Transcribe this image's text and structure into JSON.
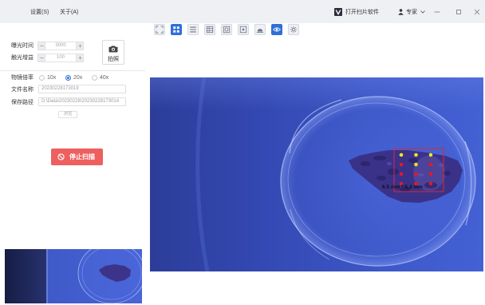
{
  "window": {
    "menu": [
      {
        "label": "设置(S)"
      },
      {
        "label": "关于(A)"
      }
    ],
    "open_scanner_label": "打开扫片软件",
    "user_name": "专家"
  },
  "toolbar": {
    "icons": [
      {
        "icon": "crop-frame-icon",
        "active": false
      },
      {
        "icon": "grid-icon",
        "active": true
      },
      {
        "icon": "list-icon",
        "active": false
      },
      {
        "icon": "table-icon",
        "active": false
      },
      {
        "icon": "target-icon",
        "active": false
      },
      {
        "icon": "focus-icon",
        "active": false
      },
      {
        "icon": "dome-icon",
        "active": false
      },
      {
        "icon": "eye-icon",
        "active": true
      },
      {
        "icon": "settings-icon",
        "active": false
      }
    ]
  },
  "camera": {
    "exposure_time": {
      "label": "曝光时间",
      "value": "3000"
    },
    "gain": {
      "label": "触光增益",
      "value": "100"
    },
    "capture_label": "拍照"
  },
  "objective": {
    "label": "物镜倍率",
    "options": [
      "10x",
      "20x",
      "40x"
    ],
    "selected_index": 1
  },
  "file_name": {
    "label": "文件名称",
    "value": "20230228173019"
  },
  "save_path": {
    "label": "保存路径",
    "value": "D:\\Data\\20230228\\20230228173014",
    "browse_label": "浏览"
  },
  "scan": {
    "stop_label": "停止扫描"
  },
  "preview": {
    "region_size_label": "6.5 mm * 5.4 mm",
    "point_colors": [
      [
        "#f4e41c",
        "#f4e41c",
        "#f4e41c"
      ],
      [
        "#e3182c",
        "#f4e41c",
        "#e3182c"
      ],
      [
        "#e3182c",
        "#e3182c",
        "#e3182c"
      ],
      [
        "#e3182c",
        "#e3182c",
        "#e3182c"
      ]
    ]
  },
  "colors": {
    "accent": "#2f6fd6",
    "stop_button": "#ee5f5f",
    "region_outline": "#d8283a"
  }
}
